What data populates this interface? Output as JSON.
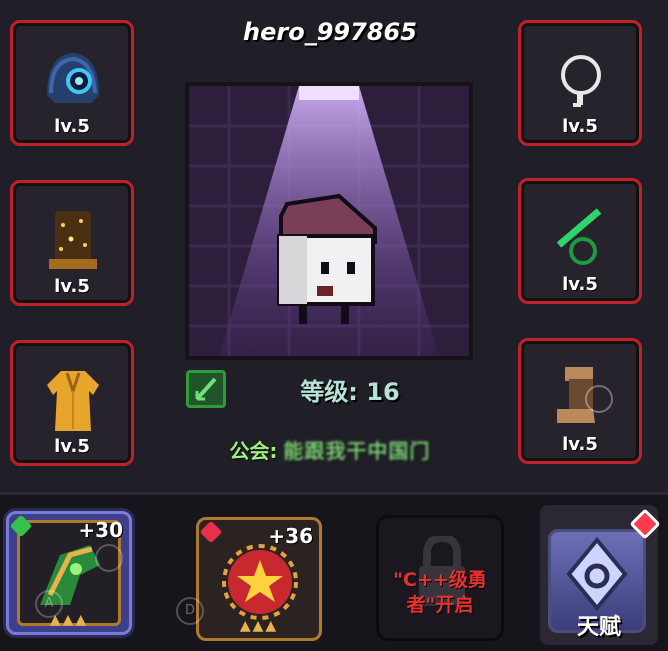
{
  "player": {
    "name": "hero_997865",
    "level_text": "等级: 16",
    "guild_label": "公会:",
    "guild_value": "能跟我干中国门"
  },
  "equipment_left": [
    {
      "slot": "helmet",
      "level": "lv.5",
      "icon": "helmet-icon"
    },
    {
      "slot": "armor-top",
      "level": "lv.5",
      "icon": "golden-vest-icon"
    },
    {
      "slot": "robe",
      "level": "lv.5",
      "icon": "robe-icon"
    }
  ],
  "equipment_right": [
    {
      "slot": "necklace",
      "level": "lv.5",
      "icon": "necklace-icon"
    },
    {
      "slot": "ring",
      "level": "lv.5",
      "icon": "jade-ring-icon"
    },
    {
      "slot": "boots",
      "level": "lv.5",
      "icon": "boots-icon"
    }
  ],
  "weapons": [
    {
      "plus": "+30",
      "gem_color": "#35c24a",
      "stars": "▲▲▲",
      "key": "A",
      "selected": true,
      "icon": "green-gold-staff-icon"
    },
    {
      "plus": "+36",
      "gem_color": "#e8304b",
      "stars": "▲▲▲",
      "key": "D",
      "selected": false,
      "icon": "red-star-orb-icon"
    }
  ],
  "locked_slot": {
    "text": "\"C++级勇者\"开启",
    "icon": "lock-icon"
  },
  "talent": {
    "label": "天赋",
    "icon": "talent-emblem-icon"
  },
  "colors": {
    "slot_border": "#c0202b",
    "level_text": "#b5e3d6",
    "guild_label": "#9cf27a",
    "locked_text": "#e8302e",
    "selected_card": "#3d3f8a"
  }
}
